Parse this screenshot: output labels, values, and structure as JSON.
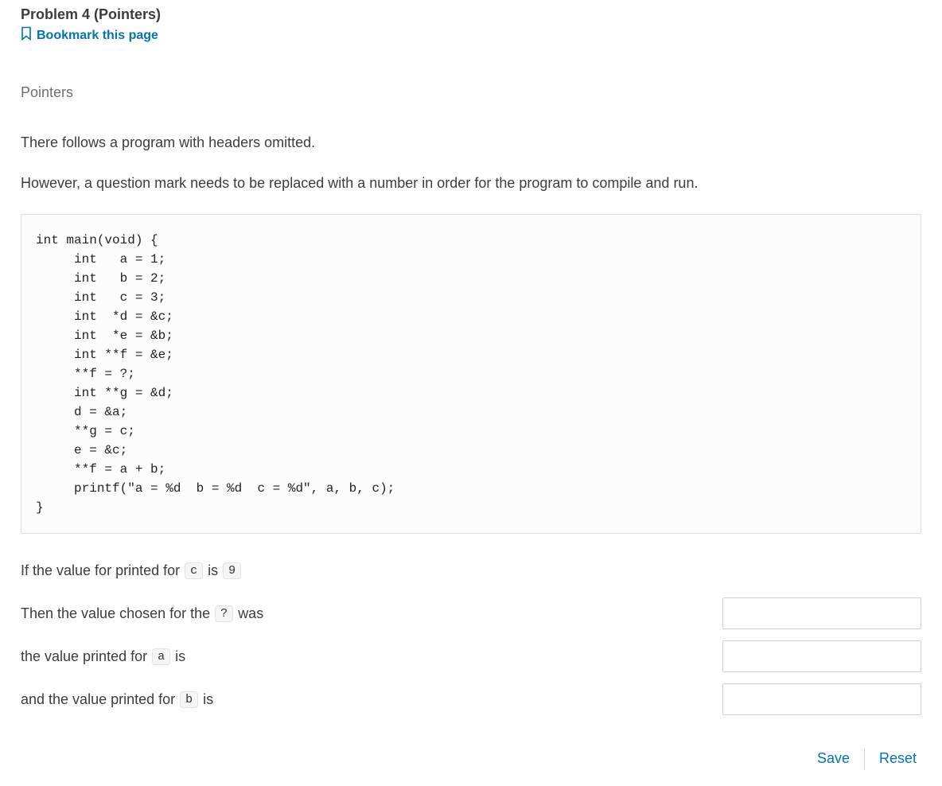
{
  "header": {
    "title": "Problem 4 (Pointers)",
    "bookmark_label": "Bookmark this page"
  },
  "subtitle": "Pointers",
  "paragraphs": {
    "p1": "There follows a program with headers omitted.",
    "p2": "However, a question mark needs to be replaced with a number in order for the program to compile and run."
  },
  "code": "int main(void) {\n     int   a = 1;\n     int   b = 2;\n     int   c = 3;\n     int  *d = &c;\n     int  *e = &b;\n     int **f = &e;\n     **f = ?;\n     int **g = &d;\n     d = &a;\n     **g = c;\n     e = &c;\n     **f = a + b;\n     printf(\"a = %d  b = %d  c = %d\", a, b, c);\n}",
  "answers": {
    "r1": {
      "t0": "If the value for printed for",
      "pill0": "c",
      "t1": "is",
      "pill1": "9"
    },
    "r2": {
      "t0": "Then the value chosen for the",
      "pill0": "?",
      "t1": "was"
    },
    "r3": {
      "t0": "the value printed for",
      "pill0": "a",
      "t1": "is"
    },
    "r4": {
      "t0": "and the value printed for",
      "pill0": "b",
      "t1": "is"
    }
  },
  "buttons": {
    "save": "Save",
    "reset": "Reset"
  }
}
